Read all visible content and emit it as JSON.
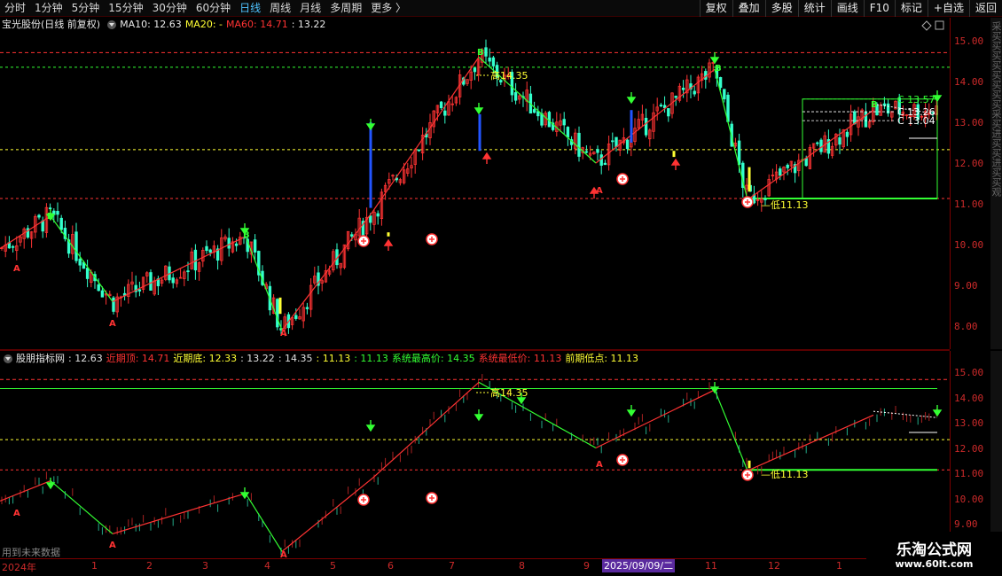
{
  "toolbar": {
    "tabs": [
      "分时",
      "1分钟",
      "5分钟",
      "15分钟",
      "30分钟",
      "60分钟",
      "日线",
      "周线",
      "月线",
      "多周期",
      "更多 〉"
    ],
    "active_tab": "日线",
    "buttons": [
      "复权",
      "叠加",
      "多股",
      "统计",
      "画线",
      "F10",
      "标记",
      "+自选",
      "返回"
    ]
  },
  "main_header": {
    "title": "宝光股份(日线 前复权)",
    "ma10": "MA10: 12.63",
    "ma20": "MA20: -",
    "ma60": "MA60: 14.71",
    "last": ": 13.22"
  },
  "sub_header": {
    "title": "股朋指标网",
    "items": [
      {
        "text": ": 12.63",
        "color": "#e0e0e0"
      },
      {
        "text": "近期顶: 14.71",
        "color": "#ff3333"
      },
      {
        "text": "近期底: 12.33",
        "color": "#ffff33"
      },
      {
        "text": ": 13.22",
        "color": "#e0e0e0"
      },
      {
        "text": ": 14.35",
        "color": "#e0e0e0"
      },
      {
        "text": ": 11.13",
        "color": "#ffff33"
      },
      {
        "text": ": 11.13",
        "color": "#33ff33"
      },
      {
        "text": "系统最高价: 14.35",
        "color": "#33ff33"
      },
      {
        "text": "系统最低价: 11.13",
        "color": "#ff3333"
      },
      {
        "text": "前期低点: 11.13",
        "color": "#ffff33"
      }
    ]
  },
  "price_axis_main": [
    "15.00",
    "14.00",
    "13.00",
    "12.00",
    "11.00",
    "10.00",
    "9.00",
    "8.00"
  ],
  "price_axis_sub": [
    "15.00",
    "14.00",
    "13.00",
    "12.00",
    "11.00",
    "10.00",
    "9.00"
  ],
  "dates": [
    "2024年",
    "1",
    "2",
    "3",
    "4",
    "5",
    "6",
    "7",
    "8",
    "9",
    "10",
    "11",
    "12",
    "1"
  ],
  "crosshair_date": "2025/09/09/二",
  "annotations": {
    "high_label": "高14.35",
    "low_label": "低11.13",
    "c_labels": [
      "C 13.57",
      "C 13.26",
      "C 13.04"
    ]
  },
  "future_note": "用到未来数据",
  "watermark": {
    "title": "乐淘公式网",
    "url": "www.60lt.com"
  },
  "right_strip_text": "采买买买买买买买买采买进买买进买买观",
  "colors": {
    "up": "#ff3333",
    "down": "#33ffcc",
    "frame": "#7a0000",
    "green": "#33ff33",
    "yellow": "#ffff33"
  },
  "chart_data": {
    "type": "line",
    "title": "宝光股份(日线 前复权)",
    "x": [
      "2024年",
      "1",
      "2",
      "3",
      "4",
      "5",
      "6",
      "7",
      "8",
      "9",
      "10",
      "11",
      "12",
      "1"
    ],
    "ylim": [
      7.6,
      15.3
    ],
    "series": [
      {
        "values": [
          9.9,
          10.7,
          8.6,
          10.2,
          7.9,
          10.8,
          14.6,
          12.0,
          14.3,
          11.1,
          13.3
        ]
      }
    ],
    "levels": [
      14.71,
      14.35,
      12.33,
      11.13
    ]
  }
}
